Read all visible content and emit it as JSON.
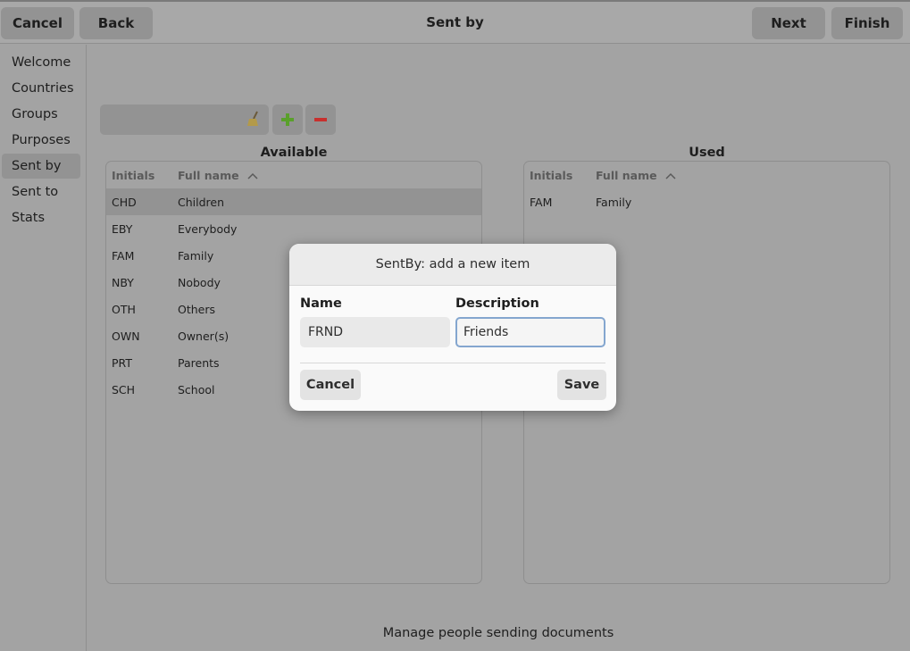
{
  "header": {
    "title": "Sent by",
    "cancel_label": "Cancel",
    "back_label": "Back",
    "next_label": "Next",
    "finish_label": "Finish"
  },
  "sidebar": {
    "items": [
      {
        "label": "Welcome"
      },
      {
        "label": "Countries"
      },
      {
        "label": "Groups"
      },
      {
        "label": "Purposes"
      },
      {
        "label": "Sent by",
        "active": true
      },
      {
        "label": "Sent to"
      },
      {
        "label": "Stats"
      }
    ]
  },
  "toolbar": {
    "filter_value": "",
    "icons": [
      "broom-icon",
      "add-icon",
      "remove-icon"
    ],
    "add_color": "#5aa02c",
    "remove_color": "#d0302f"
  },
  "available": {
    "title": "Available",
    "col_initials": "Initials",
    "col_fullname": "Full name",
    "sort_icon": "sort-ascending-icon",
    "rows": [
      {
        "initials": "CHD",
        "name": "Children",
        "selected": true
      },
      {
        "initials": "EBY",
        "name": "Everybody"
      },
      {
        "initials": "FAM",
        "name": "Family"
      },
      {
        "initials": "NBY",
        "name": "Nobody"
      },
      {
        "initials": "OTH",
        "name": "Others"
      },
      {
        "initials": "OWN",
        "name": "Owner(s)"
      },
      {
        "initials": "PRT",
        "name": "Parents"
      },
      {
        "initials": "SCH",
        "name": "School"
      }
    ]
  },
  "used": {
    "title": "Used",
    "col_initials": "Initials",
    "col_fullname": "Full name",
    "sort_icon": "sort-ascending-icon",
    "rows": [
      {
        "initials": "FAM",
        "name": "Family"
      }
    ]
  },
  "footer": {
    "text": "Manage people sending documents"
  },
  "dialog": {
    "title": "SentBy: add a new item",
    "name_label": "Name",
    "name_value": "FRND",
    "description_label": "Description",
    "description_value": "Friends",
    "cancel_label": "Cancel",
    "save_label": "Save"
  }
}
